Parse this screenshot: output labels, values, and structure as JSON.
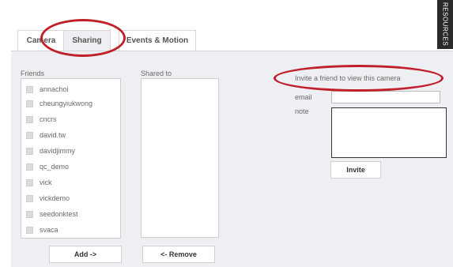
{
  "tabs": [
    {
      "label": "Camera"
    },
    {
      "label": "Sharing"
    },
    {
      "label": "Events & Motion"
    }
  ],
  "hud_text": "RESOURCES",
  "friends": {
    "label": "Friends",
    "items": [
      {
        "name": "annachoi"
      },
      {
        "name": "cheungyiukwong"
      },
      {
        "name": "cncrs"
      },
      {
        "name": "david.tw"
      },
      {
        "name": "davidjimmy"
      },
      {
        "name": "qc_demo"
      },
      {
        "name": "vick"
      },
      {
        "name": "vickdemo"
      },
      {
        "name": "seedonktest"
      },
      {
        "name": "svaca"
      }
    ],
    "add_label": "Add ->"
  },
  "shared": {
    "label": "Shared to",
    "remove_label": "<- Remove"
  },
  "invite": {
    "title": "Invite a friend to view this camera",
    "email_label": "email",
    "email_value": "",
    "note_label": "note",
    "note_value": "",
    "button_label": "Invite"
  },
  "colors": {
    "annotation": "#c0202a",
    "panel": "#eeeff3"
  }
}
